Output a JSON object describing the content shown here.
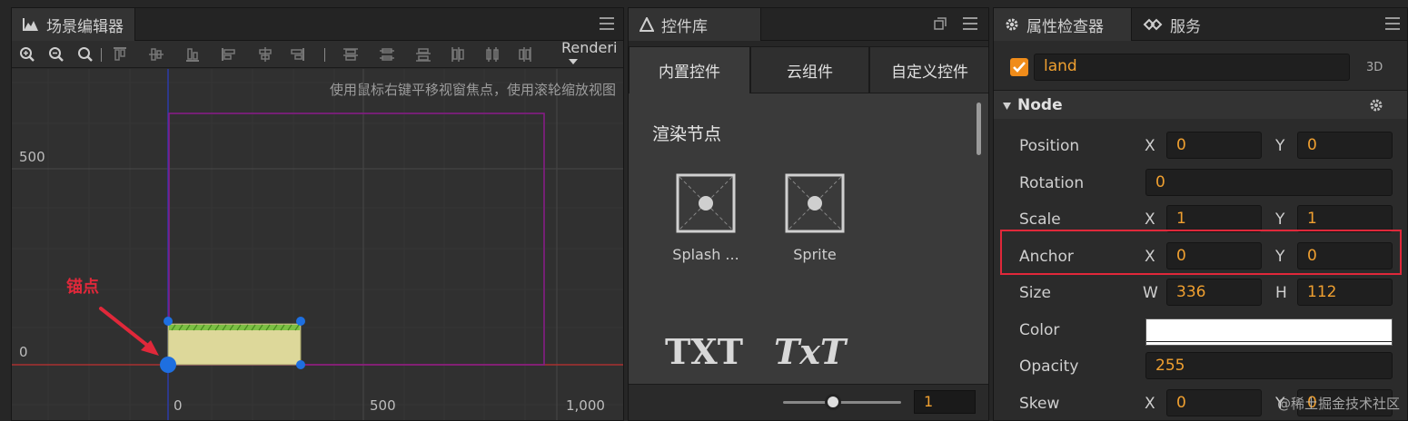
{
  "scene_editor": {
    "title": "场景编辑器",
    "render_label": "Renderi",
    "hint": "使用鼠标右键平移视窗焦点，使用滚轮缩放视图",
    "y_label_500": "500",
    "y_label_0": "0",
    "x_label_0": "0",
    "x_label_500": "500",
    "x_label_1000": "1,000",
    "anchor_annotation": "锚点"
  },
  "widget_library": {
    "title": "控件库",
    "tabs": [
      "内置控件",
      "云组件",
      "自定义控件"
    ],
    "section_title": "渲染节点",
    "widgets": [
      "Splash ...",
      "Sprite"
    ],
    "text_widgets": [
      "TXT",
      "TxT"
    ],
    "zoom_value": "1"
  },
  "inspector": {
    "tabs": [
      "属性检查器",
      "服务"
    ],
    "node_name": "land",
    "tag_3d": "3D",
    "section": "Node",
    "position": {
      "label": "Position",
      "x_axis": "X",
      "x": "0",
      "y_axis": "Y",
      "y": "0"
    },
    "rotation": {
      "label": "Rotation",
      "value": "0"
    },
    "scale": {
      "label": "Scale",
      "x_axis": "X",
      "x": "1",
      "y_axis": "Y",
      "y": "1"
    },
    "anchor": {
      "label": "Anchor",
      "x_axis": "X",
      "x": "0",
      "y_axis": "Y",
      "y": "0"
    },
    "size": {
      "label": "Size",
      "w_axis": "W",
      "w": "336",
      "h_axis": "H",
      "h": "112"
    },
    "color": {
      "label": "Color",
      "value": "#ffffff"
    },
    "opacity": {
      "label": "Opacity",
      "value": "255"
    },
    "skew": {
      "label": "Skew",
      "x_axis": "X",
      "x": "0",
      "y_axis": "Y",
      "y": "0"
    },
    "watermark": "@稀土掘金技术社区"
  },
  "colors": {
    "accent": "#f0a030",
    "selection_blue": "#1e6fe0",
    "annotation_red": "#e0283a",
    "canvas_purple": "#8a1a8a"
  }
}
